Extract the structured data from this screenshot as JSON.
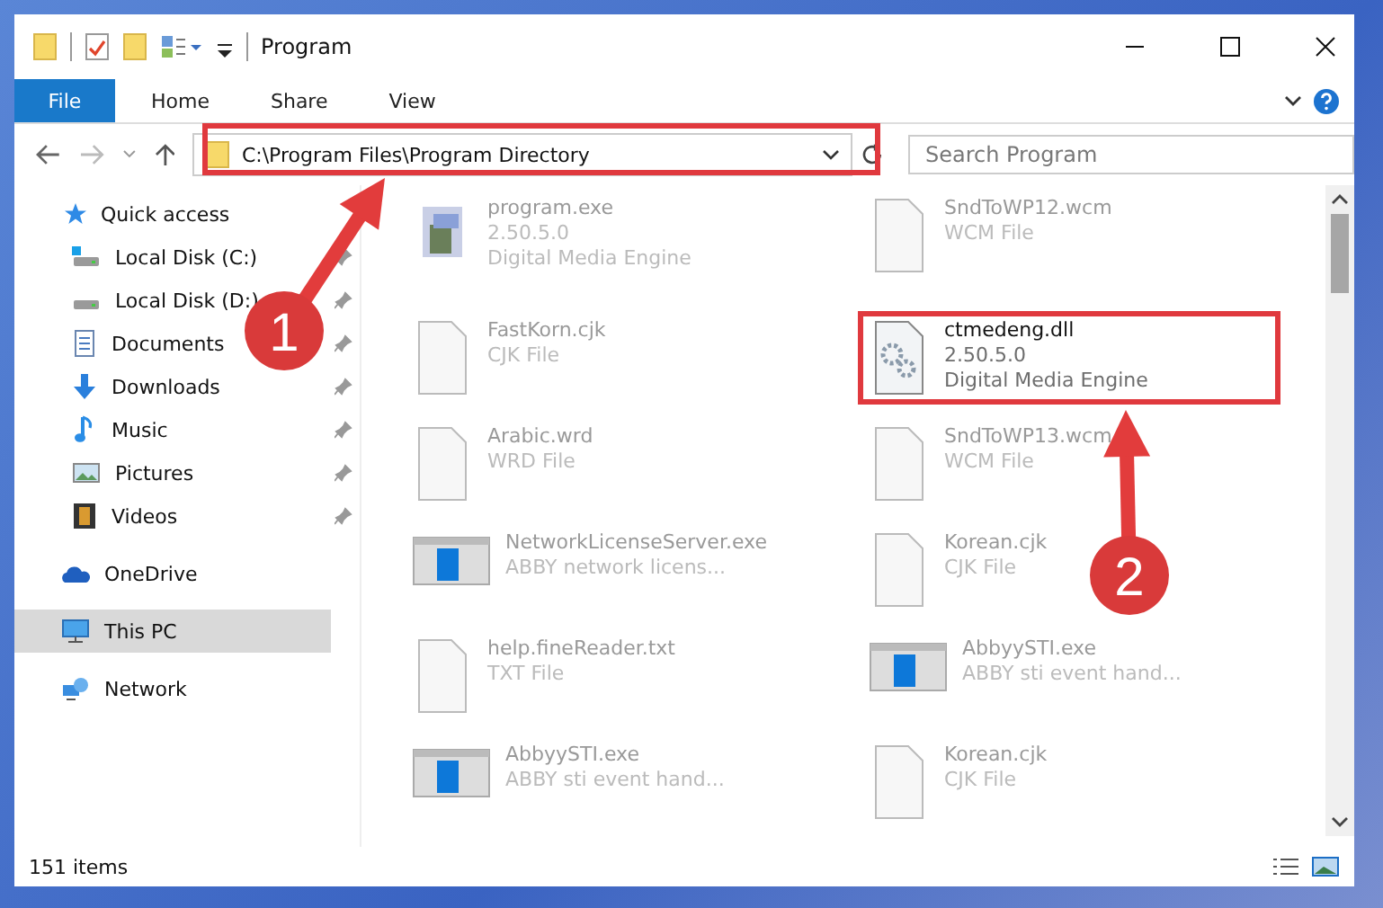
{
  "window": {
    "title": "Program"
  },
  "ribbon": {
    "tabs": [
      {
        "label": "File",
        "selected": true
      },
      {
        "label": "Home",
        "selected": false
      },
      {
        "label": "Share",
        "selected": false
      },
      {
        "label": "View",
        "selected": false
      }
    ]
  },
  "address_bar": {
    "path": "C:\\Program Files\\Program Directory",
    "search": {
      "placeholder": "Search Program"
    }
  },
  "sidebar": {
    "items": [
      {
        "label": "Quick access",
        "kind": "star",
        "selected": false,
        "children": [
          {
            "label": "Local Disk (C:)",
            "kind": "disk-c",
            "pinned": true
          },
          {
            "label": "Local Disk (D:)",
            "kind": "disk",
            "pinned": true
          },
          {
            "label": "Documents",
            "kind": "documents",
            "pinned": true
          },
          {
            "label": "Downloads",
            "kind": "downloads",
            "pinned": true
          },
          {
            "label": "Music",
            "kind": "music",
            "pinned": true
          },
          {
            "label": "Pictures",
            "kind": "pictures",
            "pinned": true
          },
          {
            "label": "Videos",
            "kind": "videos",
            "pinned": true
          }
        ]
      },
      {
        "label": "OneDrive",
        "kind": "cloud",
        "selected": false
      },
      {
        "label": "This PC",
        "kind": "pc",
        "selected": true
      },
      {
        "label": "Network",
        "kind": "network",
        "selected": false
      }
    ]
  },
  "files": [
    {
      "name": "program.exe",
      "kind": "app",
      "details": [
        "2.50.5.0",
        "Digital Media Engine"
      ],
      "highlighted": false
    },
    {
      "name": "SndToWP12.wcm",
      "kind": "doc",
      "details": [
        "WCM File"
      ],
      "highlighted": false
    },
    {
      "name": "FastKorn.cjk",
      "kind": "doc",
      "details": [
        "CJK File"
      ],
      "highlighted": false
    },
    {
      "name": "ctmedeng.dll",
      "kind": "gear",
      "details": [
        "2.50.5.0",
        "Digital Media Engine"
      ],
      "highlighted": true
    },
    {
      "name": "Arabic.wrd",
      "kind": "doc",
      "details": [
        "WRD File"
      ],
      "highlighted": false
    },
    {
      "name": "SndToWP13.wcm",
      "kind": "doc",
      "details": [
        "WCM File"
      ],
      "highlighted": false
    },
    {
      "name": "NetworkLicenseServer.exe",
      "kind": "window",
      "details": [
        "ABBY network licens..."
      ],
      "highlighted": false
    },
    {
      "name": "Korean.cjk",
      "kind": "doc",
      "details": [
        "CJK File"
      ],
      "highlighted": false
    },
    {
      "name": "help.fineReader.txt",
      "kind": "doc",
      "details": [
        "TXT File"
      ],
      "highlighted": false
    },
    {
      "name": "AbbyySTI.exe",
      "kind": "window",
      "details": [
        "ABBY sti event hand..."
      ],
      "highlighted": false
    },
    {
      "name": "AbbyySTI.exe",
      "kind": "window",
      "details": [
        "ABBY sti event hand..."
      ],
      "highlighted": false
    },
    {
      "name": "Korean.cjk",
      "kind": "doc",
      "details": [
        "CJK File"
      ],
      "highlighted": false
    }
  ],
  "status_bar": {
    "text": "151 items"
  },
  "annotations": [
    {
      "number": "1"
    },
    {
      "number": "2"
    }
  ]
}
